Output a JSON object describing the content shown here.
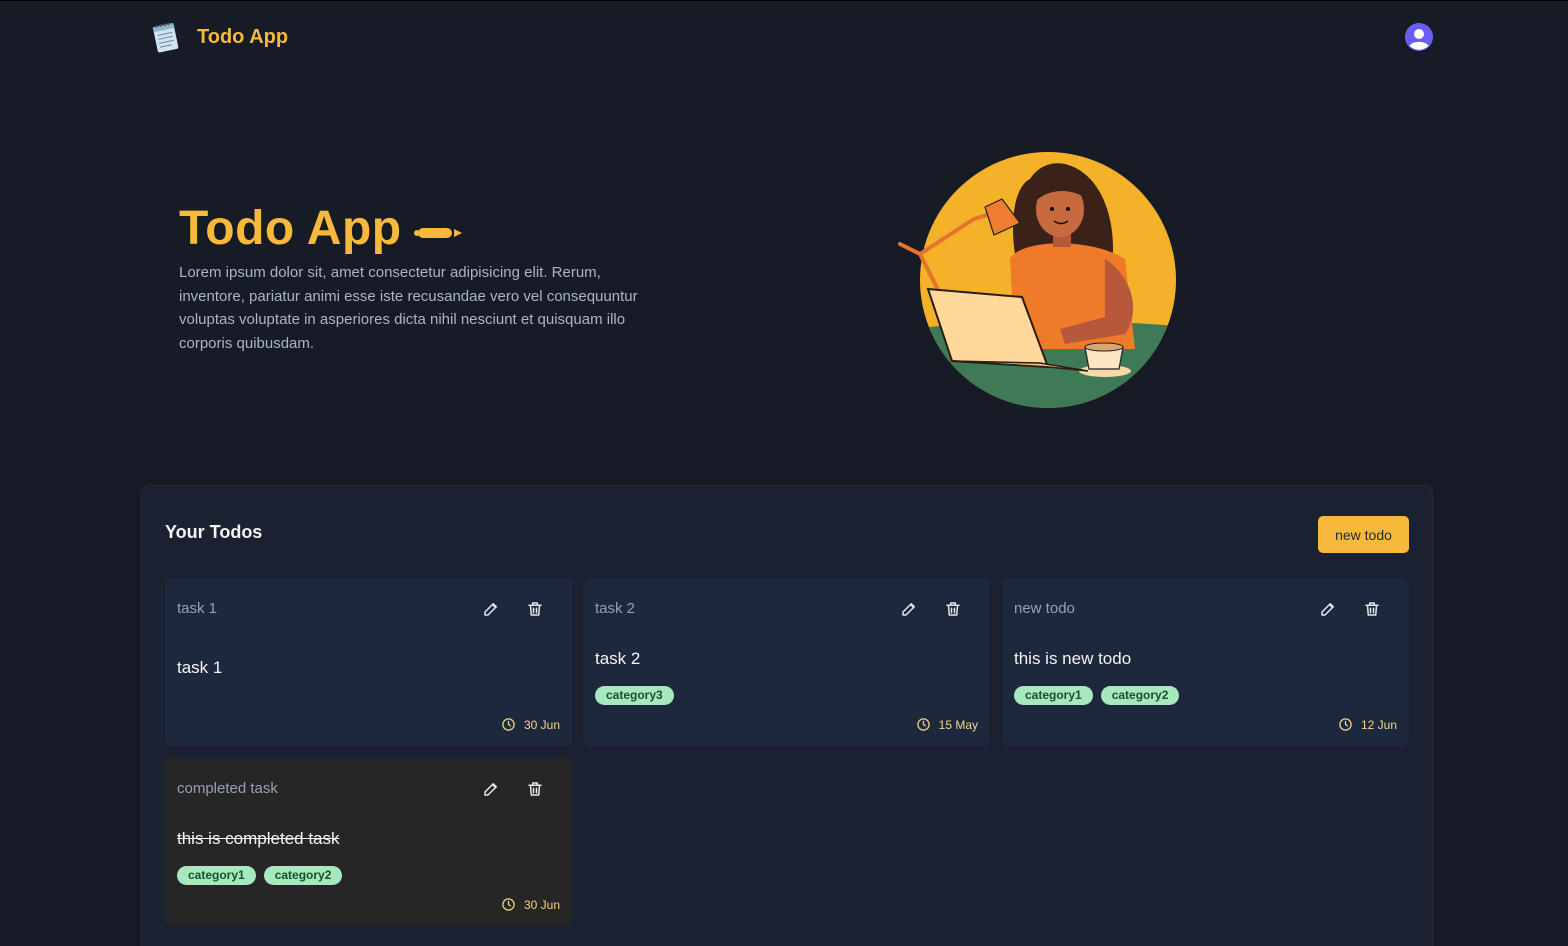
{
  "app": {
    "title": "Todo App"
  },
  "colors": {
    "accent": "#f6b93b",
    "background": "#171b26",
    "tag": "#a7e9be"
  },
  "navbar": {
    "logo_icon": "notepad-icon",
    "avatar_icon": "user-avatar-icon"
  },
  "hero": {
    "title": "Todo App",
    "description": "Lorem ipsum dolor sit, amet consectetur adipisicing elit. Rerum, inventore, pariatur animi esse iste recusandae vero vel consequuntur voluptas voluptate in asperiores dicta nihil nesciunt et quisquam illo corporis quibusdam."
  },
  "todos": {
    "title": "Your Todos",
    "new_button": "new todo",
    "cards": [
      {
        "heading": "task 1",
        "body": "task 1",
        "tags": [],
        "date": "30 Jun",
        "completed": false
      },
      {
        "heading": "task 2",
        "body": "task 2",
        "tags": [
          "category3"
        ],
        "date": "15 May",
        "completed": false
      },
      {
        "heading": "new todo",
        "body": "this is new todo",
        "tags": [
          "category1",
          "category2"
        ],
        "date": "12 Jun",
        "completed": false
      },
      {
        "heading": "completed task",
        "body": "this is completed task",
        "tags": [
          "category1",
          "category2"
        ],
        "date": "30 Jun",
        "completed": true
      }
    ]
  }
}
